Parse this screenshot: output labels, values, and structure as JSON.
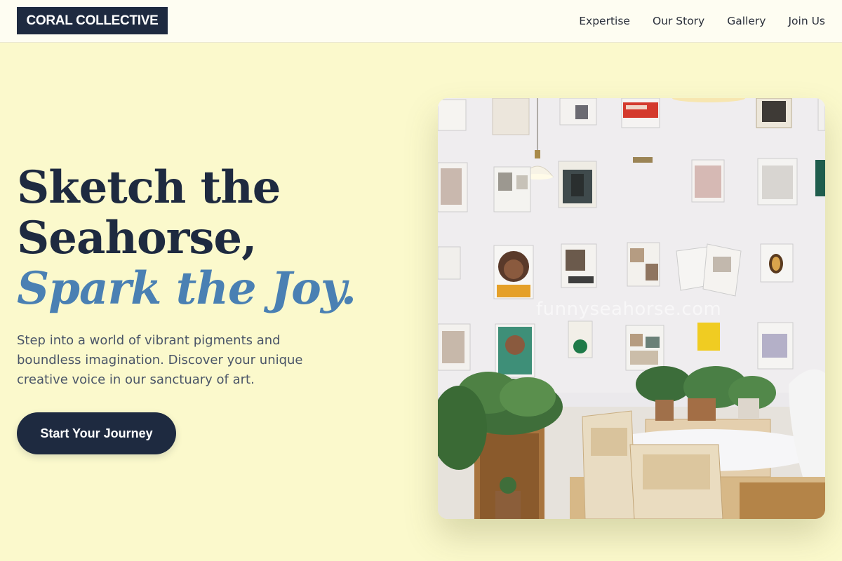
{
  "header": {
    "logo": "CORAL COLLECTIVE",
    "nav": [
      "Expertise",
      "Our Story",
      "Gallery",
      "Join Us"
    ]
  },
  "hero": {
    "headline_line1": "Sketch the",
    "headline_line2": "Seahorse,",
    "headline_accent": "Spark the Joy.",
    "subtext": "Step into a world of vibrant pigments and boundless imagination. Discover your unique creative voice in our sanctuary of art.",
    "cta_label": "Start Your Journey"
  },
  "image": {
    "watermark": "funnyseahorse.com"
  },
  "colors": {
    "page_background": "#fbf9cc",
    "navy": "#1e2a40",
    "accent_blue": "#4a80b3",
    "body_text": "#4a5568"
  }
}
